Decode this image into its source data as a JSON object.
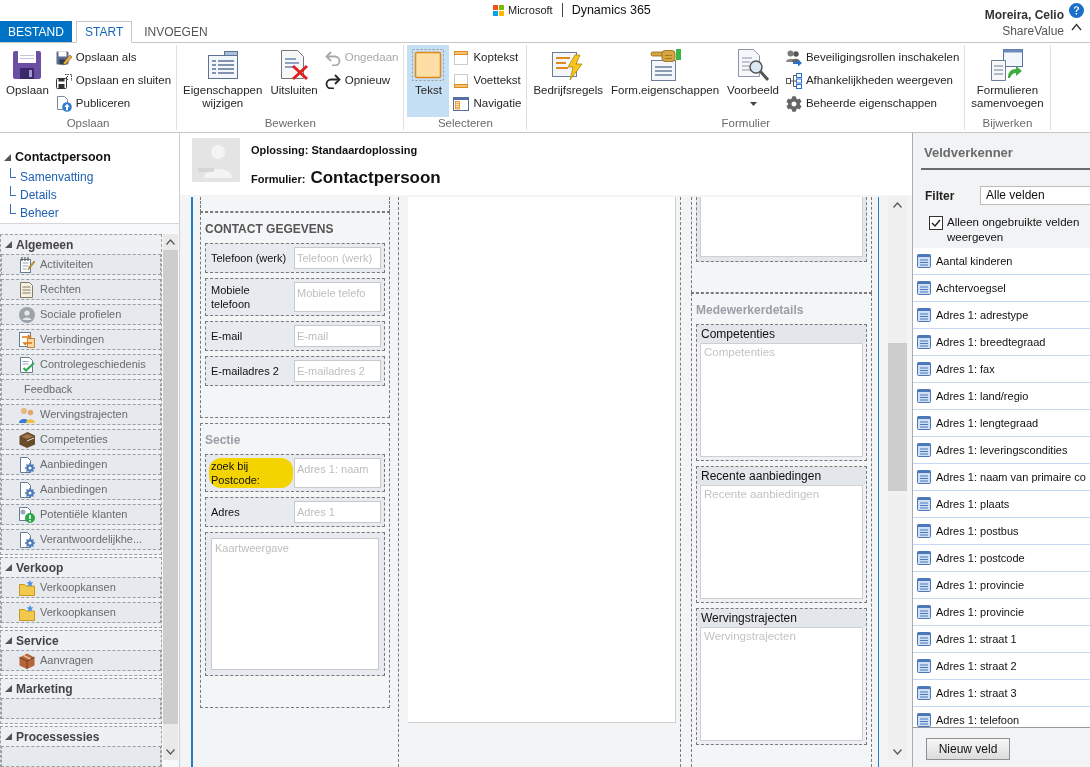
{
  "header": {
    "brand": "Microsoft",
    "product": "Dynamics 365",
    "user_name": "Moreira, Celio",
    "organization": "ShareValue"
  },
  "tabs": [
    {
      "label": "BESTAND",
      "kind": "file",
      "selected": false
    },
    {
      "label": "START",
      "kind": "tab",
      "selected": true
    },
    {
      "label": "INVOEGEN",
      "kind": "tab",
      "selected": false
    }
  ],
  "ribbon": {
    "groups": [
      {
        "label": "Opslaan",
        "items": [
          {
            "kind": "large",
            "label": "Opslaan",
            "disabled": false
          },
          {
            "kind": "small",
            "label": "Opslaan als",
            "disabled": false
          },
          {
            "kind": "small",
            "label": "Opslaan en sluiten",
            "disabled": false
          },
          {
            "kind": "small",
            "label": "Publiceren",
            "disabled": false
          }
        ]
      },
      {
        "label": "Bewerken",
        "items": [
          {
            "kind": "large",
            "label": "Eigenschappen wijzigen",
            "disabled": false
          },
          {
            "kind": "large",
            "label": "Uitsluiten",
            "disabled": false
          },
          {
            "kind": "small",
            "label": "Ongedaan",
            "disabled": true
          },
          {
            "kind": "small",
            "label": "Opnieuw",
            "disabled": false
          }
        ]
      },
      {
        "label": "Selecteren",
        "items": [
          {
            "kind": "large",
            "label": "Tekst",
            "disabled": false,
            "selected": true
          },
          {
            "kind": "small",
            "label": "Koptekst",
            "disabled": false,
            "selected": false
          },
          {
            "kind": "small",
            "label": "Voettekst",
            "disabled": false,
            "selected": false
          },
          {
            "kind": "small",
            "label": "Navigatie",
            "disabled": false,
            "selected": false
          }
        ]
      },
      {
        "label": "Formulier",
        "items": [
          {
            "kind": "large",
            "label": "Bedrijfsregels",
            "disabled": false
          },
          {
            "kind": "large",
            "label": "Form.eigenschappen",
            "disabled": false
          },
          {
            "kind": "dropdown",
            "label": "Voorbeeld",
            "disabled": false
          },
          {
            "kind": "small",
            "label": "Beveiligingsrollen inschakelen",
            "disabled": false
          },
          {
            "kind": "small",
            "label": "Afhankelijkheden weergeven",
            "disabled": false
          },
          {
            "kind": "small",
            "label": "Beheerde eigenschappen",
            "disabled": false
          }
        ]
      },
      {
        "label": "Bijwerken",
        "items": [
          {
            "kind": "large",
            "label": "Formulieren samenvoegen",
            "disabled": false
          }
        ]
      }
    ]
  },
  "navigation": {
    "record": {
      "label": "Contactpersoon",
      "expanded": true,
      "children": [
        {
          "label": "Samenvatting"
        },
        {
          "label": "Details"
        },
        {
          "label": "Beheer"
        }
      ]
    },
    "sections": [
      {
        "label": "Algemeen",
        "expanded": true,
        "items": [
          "Activiteiten",
          "Rechten",
          "Sociale profielen",
          "Verbindingen",
          "Controlegeschiedenis",
          "Feedback",
          "Wervingstrajecten",
          "Competenties",
          "Aanbiedingen",
          "Aanbiedingen",
          "Potentiële klanten",
          "Verantwoordelijkhe..."
        ]
      },
      {
        "label": "Verkoop",
        "expanded": true,
        "items": [
          "Verkoopkansen",
          "Verkoopkansen"
        ]
      },
      {
        "label": "Service",
        "expanded": true,
        "items": [
          "Aanvragen"
        ]
      },
      {
        "label": "Marketing",
        "expanded": true
      },
      {
        "label": "Processessies",
        "expanded": true
      }
    ]
  },
  "form": {
    "solution": "Oplossing: Standaardoplossing",
    "form_label": "Formulier:",
    "form_name": "Contactpersoon",
    "columns": [
      {
        "sections": [
          {
            "kind": "continued"
          },
          {
            "kind": "fields",
            "title": "CONTACT GEGEVENS",
            "title_visible": true,
            "fields": [
              {
                "kind": "text",
                "label": "Telefoon (werk)",
                "placeholder": "Telefoon (werk)",
                "highlighted": false
              },
              {
                "kind": "text",
                "label": "Mobiele telefoon",
                "placeholder": "Mobiele telefo",
                "highlighted": false
              },
              {
                "kind": "text",
                "label": "E-mail",
                "placeholder": "E-mail",
                "highlighted": false
              },
              {
                "kind": "text",
                "label": "E-mailadres 2",
                "placeholder": "E-mailadres 2",
                "highlighted": false
              }
            ]
          },
          {
            "kind": "fields",
            "title": "Sectie",
            "title_visible": false,
            "fields": [
              {
                "kind": "text",
                "label": "zoek bij Postcode:",
                "placeholder": "Adres 1: naam",
                "highlighted": true
              },
              {
                "kind": "text",
                "label": "Adres",
                "placeholder": "Adres 1",
                "highlighted": false
              },
              {
                "kind": "map",
                "placeholder": "Kaartweergave",
                "highlighted": false
              }
            ]
          }
        ]
      },
      {
        "sections": [
          {
            "kind": "blank"
          }
        ]
      },
      {
        "sections": [
          {
            "kind": "continued_subgrid"
          },
          {
            "kind": "fields",
            "title": "Medewerkerdetails",
            "title_visible": false,
            "fields": [
              {
                "kind": "subgrid",
                "label": "Competenties",
                "placeholder": "Competenties"
              },
              {
                "kind": "subgrid",
                "label": "Recente aanbiedingen",
                "placeholder": "Recente aanbiedingen"
              },
              {
                "kind": "subgrid",
                "label": "Wervingstrajecten",
                "placeholder": "Wervingstrajecten"
              }
            ]
          }
        ]
      }
    ]
  },
  "field_explorer": {
    "title": "Veldverkenner",
    "filter_label": "Filter",
    "filter_value": "Alle velden",
    "unused_only": {
      "label": "Alleen ongebruikte velden weergeven",
      "checked": true
    },
    "fields": [
      "Aantal kinderen",
      "Achtervoegsel",
      "Adres 1: adrestype",
      "Adres 1: breedtegraad",
      "Adres 1: fax",
      "Adres 1: land/regio",
      "Adres 1: lengtegraad",
      "Adres 1: leveringscondities",
      "Adres 1: naam van primaire co",
      "Adres 1: plaats",
      "Adres 1: postbus",
      "Adres 1: postcode",
      "Adres 1: provincie",
      "Adres 1: provincie",
      "Adres 1: straat 1",
      "Adres 1: straat 2",
      "Adres 1: straat 3",
      "Adres 1: telefoon"
    ],
    "new_field_button": "Nieuw veld"
  }
}
